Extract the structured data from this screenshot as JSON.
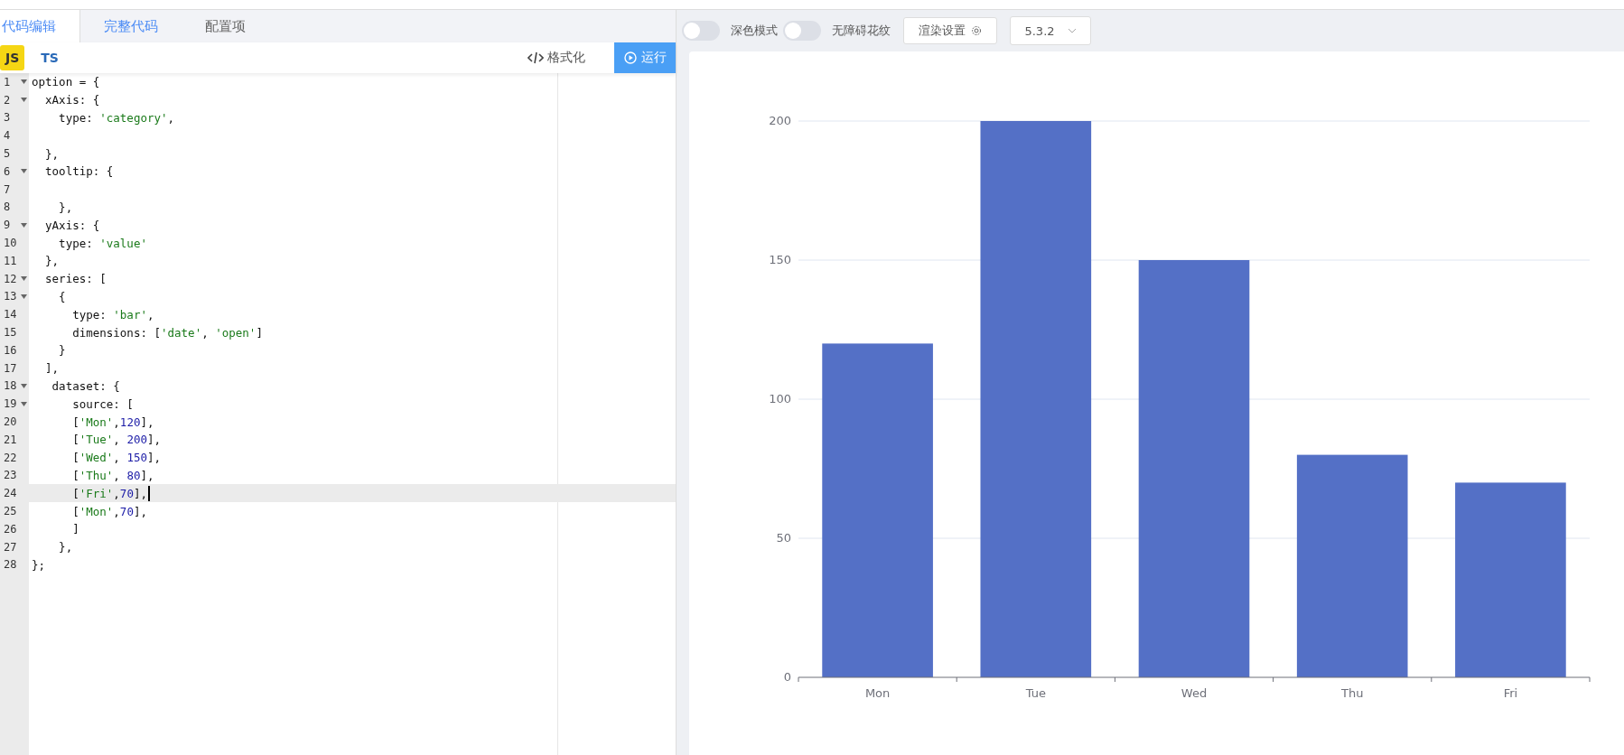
{
  "editor_tabs": [
    {
      "label": "代码编辑",
      "selected": true
    },
    {
      "label": "完整代码",
      "selected": false
    },
    {
      "label": "配置项",
      "selected": false
    }
  ],
  "languages": [
    {
      "label": "JS",
      "selected": true
    },
    {
      "label": "TS",
      "selected": false
    }
  ],
  "format_button": {
    "label": "格式化"
  },
  "run_button": {
    "label": "运行"
  },
  "code_lines": [
    {
      "number": "1",
      "fold": true,
      "selected": false,
      "tokens": [
        {
          "kind": "plain",
          "text": "option = {"
        }
      ]
    },
    {
      "number": "2",
      "fold": true,
      "selected": false,
      "tokens": [
        {
          "kind": "plain",
          "text": "  xAxis: {"
        }
      ]
    },
    {
      "number": "3",
      "fold": false,
      "selected": false,
      "tokens": [
        {
          "kind": "plain",
          "text": "    type: "
        },
        {
          "kind": "string",
          "text": "'category'"
        },
        {
          "kind": "plain",
          "text": ","
        }
      ]
    },
    {
      "number": "4",
      "fold": false,
      "selected": false
    },
    {
      "number": "5",
      "fold": false,
      "selected": false,
      "tokens": [
        {
          "kind": "plain",
          "text": "  },"
        }
      ]
    },
    {
      "number": "6",
      "fold": true,
      "selected": false,
      "tokens": [
        {
          "kind": "plain",
          "text": "  tooltip: {"
        }
      ]
    },
    {
      "number": "7",
      "fold": false,
      "selected": false
    },
    {
      "number": "8",
      "fold": false,
      "selected": false,
      "tokens": [
        {
          "kind": "plain",
          "text": "    },"
        }
      ]
    },
    {
      "number": "9",
      "fold": true,
      "selected": false,
      "tokens": [
        {
          "kind": "plain",
          "text": "  yAxis: {"
        }
      ]
    },
    {
      "number": "10",
      "fold": false,
      "selected": false,
      "tokens": [
        {
          "kind": "plain",
          "text": "    type: "
        },
        {
          "kind": "string",
          "text": "'value'"
        }
      ]
    },
    {
      "number": "11",
      "fold": false,
      "selected": false,
      "tokens": [
        {
          "kind": "plain",
          "text": "  },"
        }
      ]
    },
    {
      "number": "12",
      "fold": true,
      "selected": false,
      "tokens": [
        {
          "kind": "plain",
          "text": "  series: ["
        }
      ]
    },
    {
      "number": "13",
      "fold": true,
      "selected": false,
      "tokens": [
        {
          "kind": "plain",
          "text": "    {"
        }
      ]
    },
    {
      "number": "14",
      "fold": false,
      "selected": false,
      "tokens": [
        {
          "kind": "plain",
          "text": "      type: "
        },
        {
          "kind": "string",
          "text": "'bar'"
        },
        {
          "kind": "plain",
          "text": ","
        }
      ]
    },
    {
      "number": "15",
      "fold": false,
      "selected": false,
      "tokens": [
        {
          "kind": "plain",
          "text": "      dimensions: ["
        },
        {
          "kind": "string",
          "text": "'date'"
        },
        {
          "kind": "plain",
          "text": ", "
        },
        {
          "kind": "string",
          "text": "'open'"
        },
        {
          "kind": "plain",
          "text": "]"
        }
      ]
    },
    {
      "number": "16",
      "fold": false,
      "selected": false,
      "tokens": [
        {
          "kind": "plain",
          "text": "    }"
        }
      ]
    },
    {
      "number": "17",
      "fold": false,
      "selected": false,
      "tokens": [
        {
          "kind": "plain",
          "text": "  ],"
        }
      ]
    },
    {
      "number": "18",
      "fold": true,
      "selected": false,
      "tokens": [
        {
          "kind": "plain",
          "text": "   dataset: {"
        }
      ]
    },
    {
      "number": "19",
      "fold": true,
      "selected": false,
      "tokens": [
        {
          "kind": "plain",
          "text": "      source: ["
        }
      ]
    },
    {
      "number": "20",
      "fold": false,
      "selected": false,
      "tokens": [
        {
          "kind": "plain",
          "text": "      ["
        },
        {
          "kind": "string",
          "text": "'Mon'"
        },
        {
          "kind": "plain",
          "text": ","
        },
        {
          "kind": "number",
          "text": "120"
        },
        {
          "kind": "plain",
          "text": "],"
        }
      ]
    },
    {
      "number": "21",
      "fold": false,
      "selected": false,
      "tokens": [
        {
          "kind": "plain",
          "text": "      ["
        },
        {
          "kind": "string",
          "text": "'Tue'"
        },
        {
          "kind": "plain",
          "text": ", "
        },
        {
          "kind": "number",
          "text": "200"
        },
        {
          "kind": "plain",
          "text": "],"
        }
      ]
    },
    {
      "number": "22",
      "fold": false,
      "selected": false,
      "tokens": [
        {
          "kind": "plain",
          "text": "      ["
        },
        {
          "kind": "string",
          "text": "'Wed'"
        },
        {
          "kind": "plain",
          "text": ", "
        },
        {
          "kind": "number",
          "text": "150"
        },
        {
          "kind": "plain",
          "text": "],"
        }
      ]
    },
    {
      "number": "23",
      "fold": false,
      "selected": false,
      "tokens": [
        {
          "kind": "plain",
          "text": "      ["
        },
        {
          "kind": "string",
          "text": "'Thu'"
        },
        {
          "kind": "plain",
          "text": ", "
        },
        {
          "kind": "number",
          "text": "80"
        },
        {
          "kind": "plain",
          "text": "],"
        }
      ]
    },
    {
      "number": "24",
      "fold": false,
      "selected": true,
      "tokens": [
        {
          "kind": "plain",
          "text": "      ["
        },
        {
          "kind": "string",
          "text": "'Fri'"
        },
        {
          "kind": "plain",
          "text": ","
        },
        {
          "kind": "number",
          "text": "70"
        },
        {
          "kind": "plain",
          "text": "],"
        }
      ]
    },
    {
      "number": "25",
      "fold": false,
      "selected": false,
      "tokens": [
        {
          "kind": "plain",
          "text": "      ["
        },
        {
          "kind": "string",
          "text": "'Mon'"
        },
        {
          "kind": "plain",
          "text": ","
        },
        {
          "kind": "number",
          "text": "70"
        },
        {
          "kind": "plain",
          "text": "],"
        }
      ]
    },
    {
      "number": "26",
      "fold": false,
      "selected": false,
      "tokens": [
        {
          "kind": "plain",
          "text": "      ]"
        }
      ]
    },
    {
      "number": "27",
      "fold": false,
      "selected": false,
      "tokens": [
        {
          "kind": "plain",
          "text": "    },"
        }
      ]
    },
    {
      "number": "28",
      "fold": false,
      "selected": false,
      "tokens": [
        {
          "kind": "plain",
          "text": "};"
        }
      ]
    }
  ],
  "preview_toolbar": {
    "toggles": [
      {
        "label": "深色模式",
        "on": false
      },
      {
        "label": "无障碍花纹",
        "on": false
      }
    ],
    "render_settings": {
      "label": "渲染设置"
    },
    "version_select": {
      "value": "5.3.2"
    }
  },
  "chart_data": {
    "type": "bar",
    "categories": [
      "Mon",
      "Tue",
      "Wed",
      "Thu",
      "Fri"
    ],
    "series": [
      {
        "color": "#5470c6",
        "values": [
          120,
          200,
          150,
          80,
          70
        ]
      }
    ],
    "grid": true,
    "ylim": [
      0,
      200
    ],
    "yticks": [
      0,
      50,
      100,
      150,
      200
    ]
  }
}
